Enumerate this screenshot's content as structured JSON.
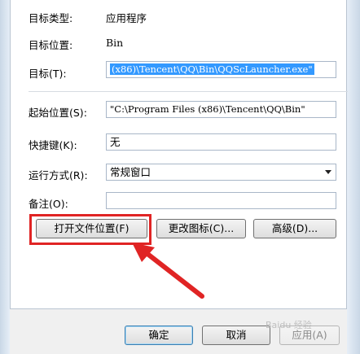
{
  "fields": {
    "target_type": {
      "label": "目标类型:",
      "value": "应用程序"
    },
    "target_location": {
      "label": "目标位置:",
      "value": "Bin"
    },
    "target": {
      "label": "目标(T):",
      "value": "(x86)\\Tencent\\QQ\\Bin\\QQScLauncher.exe\""
    },
    "start_in": {
      "label": "起始位置(S):",
      "value": "\"C:\\Program Files (x86)\\Tencent\\QQ\\Bin\""
    },
    "shortcut_key": {
      "label": "快捷键(K):",
      "value": "无"
    },
    "run": {
      "label": "运行方式(R):",
      "value": "常规窗口"
    },
    "comment": {
      "label": "备注(O):",
      "value": ""
    }
  },
  "buttons": {
    "open_file_location": "打开文件位置(F)",
    "change_icon": "更改图标(C)...",
    "advanced": "高级(D)...",
    "ok": "确定",
    "cancel": "取消",
    "apply": "应用(A)"
  },
  "watermark": "Baidu 经验",
  "colors": {
    "highlight": "#e02424",
    "selection": "#3399ff"
  },
  "icons": [
    "arrow-annotation-icon",
    "chevron-down-icon"
  ]
}
